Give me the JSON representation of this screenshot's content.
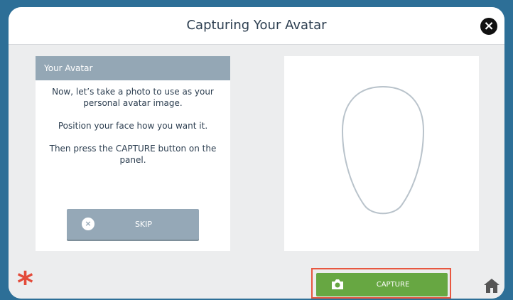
{
  "window": {
    "title": "Capturing Your Avatar",
    "close_icon": "close-icon"
  },
  "avatar_panel": {
    "header": "Your Avatar",
    "instruction_1": "Now, let’s take a photo to use as your personal avatar image.",
    "instruction_2": "Position your face how you want it.",
    "instruction_3": "Then press the CAPTURE button on the panel.",
    "skip_button": {
      "label": "SKIP",
      "icon": "skip-icon"
    }
  },
  "camera_preview": {
    "overlay": "face-outline-icon"
  },
  "bottom_bar": {
    "left_icon": "asterisk-icon",
    "capture_button": {
      "label": "CAPTURE",
      "icon": "camera-icon"
    },
    "home_icon": "home-icon"
  },
  "colors": {
    "page_background": "#2d6f97",
    "header_panel": "#94a7b5",
    "skip_button": "#95a8b7",
    "capture_button": "#67a742",
    "capture_highlight": "#e85740",
    "asterisk": "#e34b3a"
  }
}
